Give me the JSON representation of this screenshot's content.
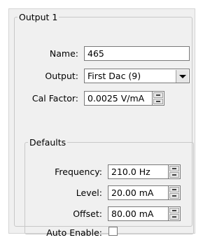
{
  "group": {
    "title": "Output 1",
    "name_label": "Name:",
    "name_value": "465",
    "output_label": "Output:",
    "output_value": "First Dac (9)",
    "cal_label": "Cal Factor:",
    "cal_value": "0.0025 V/mA"
  },
  "defaults": {
    "title": "Defaults",
    "frequency_label": "Frequency:",
    "frequency_value": "210.0 Hz",
    "level_label": "Level:",
    "level_value": "20.00 mA",
    "offset_label": "Offset:",
    "offset_value": "80.00 mA",
    "auto_enable_label": "Auto Enable:",
    "auto_enable_checked": false
  }
}
